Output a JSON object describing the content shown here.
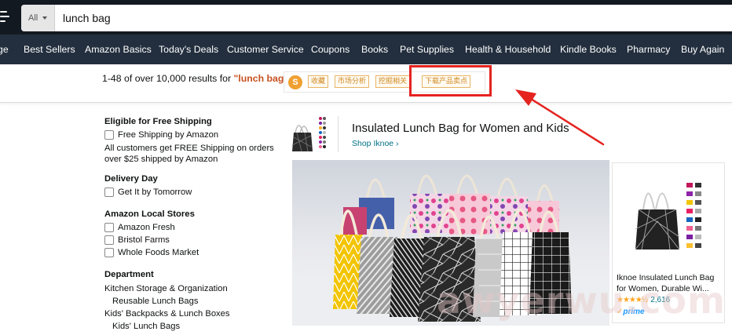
{
  "search": {
    "category_label": "All",
    "query_value": "lunch bag"
  },
  "nav": {
    "items": [
      "ge",
      "Best Sellers",
      "Amazon Basics",
      "Today's Deals",
      "Customer Service",
      "Coupons",
      "Books",
      "Pet Supplies",
      "Health & Household",
      "Kindle Books",
      "Pharmacy",
      "Buy Again"
    ]
  },
  "results": {
    "count_text": "1-48 of over 10,000 results for ",
    "query_text": "\"lunch bag\""
  },
  "plugin": {
    "logo_char": "S",
    "buttons": [
      "收藏",
      "市场分析",
      "挖掘相关",
      "下载产品卖点"
    ]
  },
  "sidebar": {
    "sections": [
      {
        "heading": "Eligible for Free Shipping",
        "checkboxes": [
          "Free Shipping by Amazon"
        ],
        "note_lines": [
          "All customers get FREE Shipping on orders",
          "over $25 shipped by Amazon"
        ]
      },
      {
        "heading": "Delivery Day",
        "checkboxes": [
          "Get It by Tomorrow"
        ]
      },
      {
        "heading": "Amazon Local Stores",
        "checkboxes": [
          "Amazon Fresh",
          "Bristol Farms",
          "Whole Foods Market"
        ]
      },
      {
        "heading": "Department",
        "links": [
          "Kitchen Storage & Organization",
          "Reusable Lunch Bags",
          "Kids' Backpacks & Lunch Boxes",
          "Kids' Lunch Bags"
        ]
      }
    ]
  },
  "banner": {
    "headline": "Insulated Lunch Bag for Women and Kids",
    "shop_link": "Shop Iknoe ›"
  },
  "product_tile": {
    "title_lines": [
      "Iknoe Insulated Lunch Bag",
      "for Women, Durable Wi..."
    ],
    "stars": "★★★★½",
    "rating": 4.5,
    "review_count": "2,616",
    "prime_check": "✓",
    "prime_label": "prime"
  },
  "watermark": "awyerwu.com",
  "colors": {
    "header_bg": "#131921",
    "nav_bg": "#232f3e",
    "query_accent": "#c7511f",
    "link": "#007185",
    "highlight_red": "#e4231f",
    "plugin_orange": "#d08a20",
    "star": "#ffa41c",
    "prime_blue": "#1a98ff"
  },
  "icons": {
    "menu": "hamburger-icon",
    "dropdown": "caret-down-icon",
    "plugin": "plugin-logo-icon",
    "annotation": "red-arrow-annotation"
  }
}
